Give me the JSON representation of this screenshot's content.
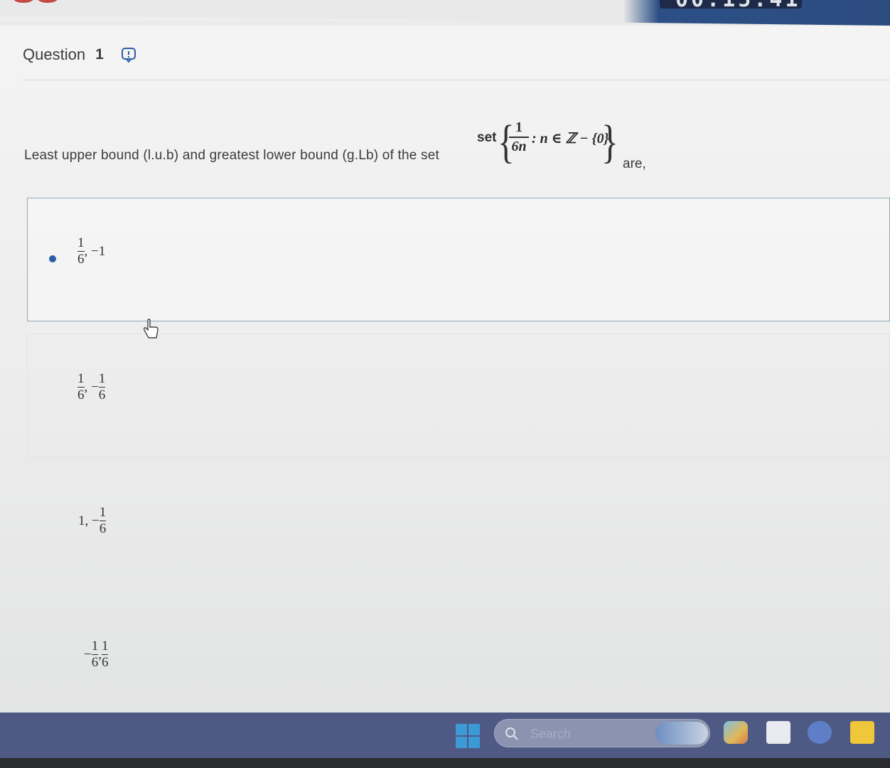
{
  "timer": {
    "text": "00:15:41"
  },
  "question": {
    "title": "Question",
    "number": "1",
    "text_before": "Least upper bound (l.u.b) and greatest lower bound (g.Lb) of the set",
    "text_after": "are,",
    "math": {
      "prefix": "set",
      "numerator": "1",
      "denominator": "6n",
      "condition": ": n ∈ ℤ − {0}"
    }
  },
  "options": [
    {
      "selected": true,
      "parts": [
        {
          "type": "frac",
          "n": "1",
          "d": "6"
        },
        {
          "type": "text",
          "v": ", −1"
        }
      ]
    },
    {
      "selected": false,
      "parts": [
        {
          "type": "frac",
          "n": "1",
          "d": "6"
        },
        {
          "type": "text",
          "v": ", −"
        },
        {
          "type": "frac",
          "n": "1",
          "d": "6"
        }
      ]
    },
    {
      "selected": false,
      "parts": [
        {
          "type": "text",
          "v": "1, −"
        },
        {
          "type": "frac",
          "n": "1",
          "d": "6"
        }
      ]
    },
    {
      "selected": false,
      "parts": [
        {
          "type": "text",
          "v": "−"
        },
        {
          "type": "frac",
          "n": "1",
          "d": "6"
        },
        {
          "type": "text",
          "v": ", "
        },
        {
          "type": "frac",
          "n": "1",
          "d": "6"
        }
      ]
    }
  ],
  "taskbar": {
    "search_placeholder": "Search"
  },
  "colors": {
    "accent": "#2b5ea7",
    "taskbar": "#4e5a84"
  }
}
